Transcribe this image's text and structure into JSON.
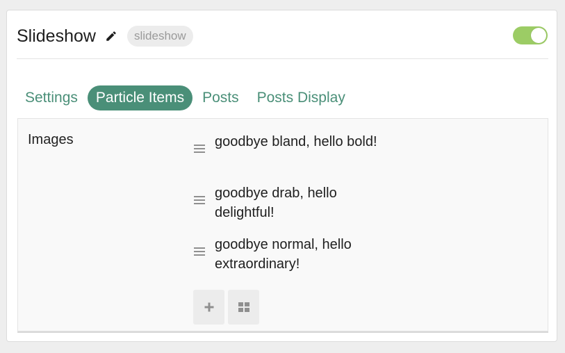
{
  "header": {
    "title": "Slideshow",
    "slug": "slideshow",
    "enabled": true
  },
  "tabs": [
    {
      "label": "Settings",
      "active": false
    },
    {
      "label": "Particle Items",
      "active": true
    },
    {
      "label": "Posts",
      "active": false
    },
    {
      "label": "Posts Display",
      "active": false
    }
  ],
  "panel": {
    "label": "Images",
    "items": [
      {
        "title": "goodbye bland, hello bold!"
      },
      {
        "title": "goodbye drab, hello delightful!"
      },
      {
        "title": "goodbye normal, hello extraordinary!"
      }
    ]
  },
  "icons": {
    "edit": "pencil-icon",
    "drag": "drag-handle-icon",
    "add": "plus-icon",
    "grid": "grid-icon"
  },
  "colors": {
    "accent": "#4a8f78",
    "toggle_on": "#9ccc65",
    "badge_text": "#9a9a9a"
  }
}
